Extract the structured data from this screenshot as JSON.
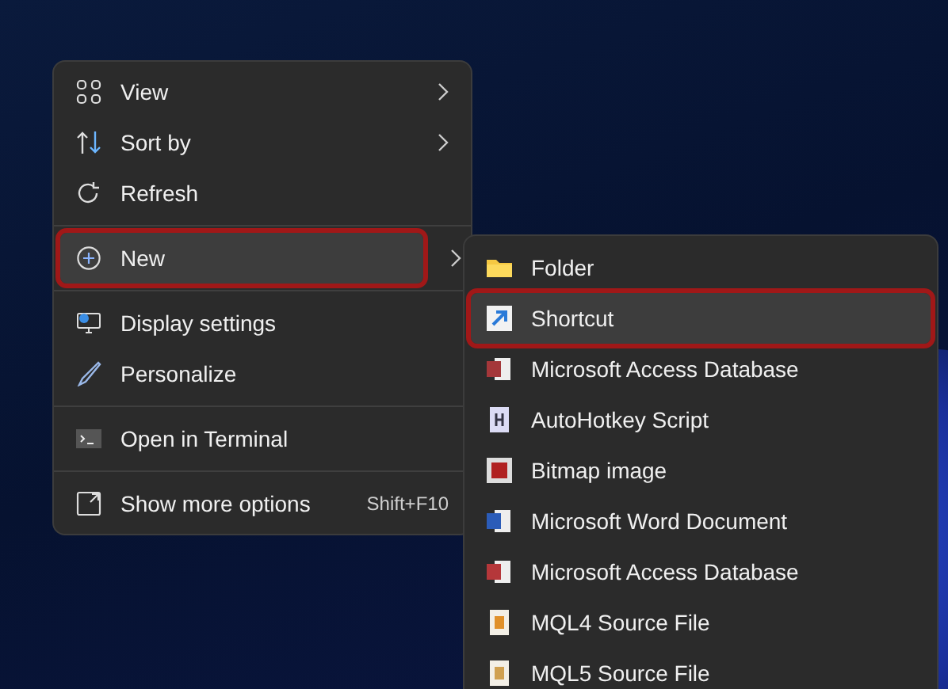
{
  "context_menu": {
    "items": [
      {
        "kind": "item",
        "label": "View",
        "submenu": true,
        "selected": false
      },
      {
        "kind": "item",
        "label": "Sort by",
        "submenu": true,
        "selected": false
      },
      {
        "kind": "item",
        "label": "Refresh",
        "submenu": false,
        "selected": false
      },
      {
        "kind": "separator"
      },
      {
        "kind": "item",
        "label": "New",
        "submenu": true,
        "selected": true
      },
      {
        "kind": "separator"
      },
      {
        "kind": "item",
        "label": "Display settings",
        "submenu": false,
        "selected": false
      },
      {
        "kind": "item",
        "label": "Personalize",
        "submenu": false,
        "selected": false
      },
      {
        "kind": "separator"
      },
      {
        "kind": "item",
        "label": "Open in Terminal",
        "submenu": false,
        "selected": false
      },
      {
        "kind": "separator"
      },
      {
        "kind": "item",
        "label": "Show more options",
        "shortcut": "Shift+F10",
        "submenu": false,
        "selected": false
      }
    ]
  },
  "new_submenu": {
    "items": [
      {
        "label": "Folder",
        "selected": false
      },
      {
        "label": "Shortcut",
        "selected": true
      },
      {
        "label": "Microsoft Access Database",
        "selected": false
      },
      {
        "label": "AutoHotkey Script",
        "selected": false
      },
      {
        "label": "Bitmap image",
        "selected": false
      },
      {
        "label": "Microsoft Word Document",
        "selected": false
      },
      {
        "label": "Microsoft Access Database",
        "selected": false
      },
      {
        "label": "MQL4 Source File",
        "selected": false
      },
      {
        "label": "MQL5 Source File",
        "selected": false
      }
    ]
  }
}
